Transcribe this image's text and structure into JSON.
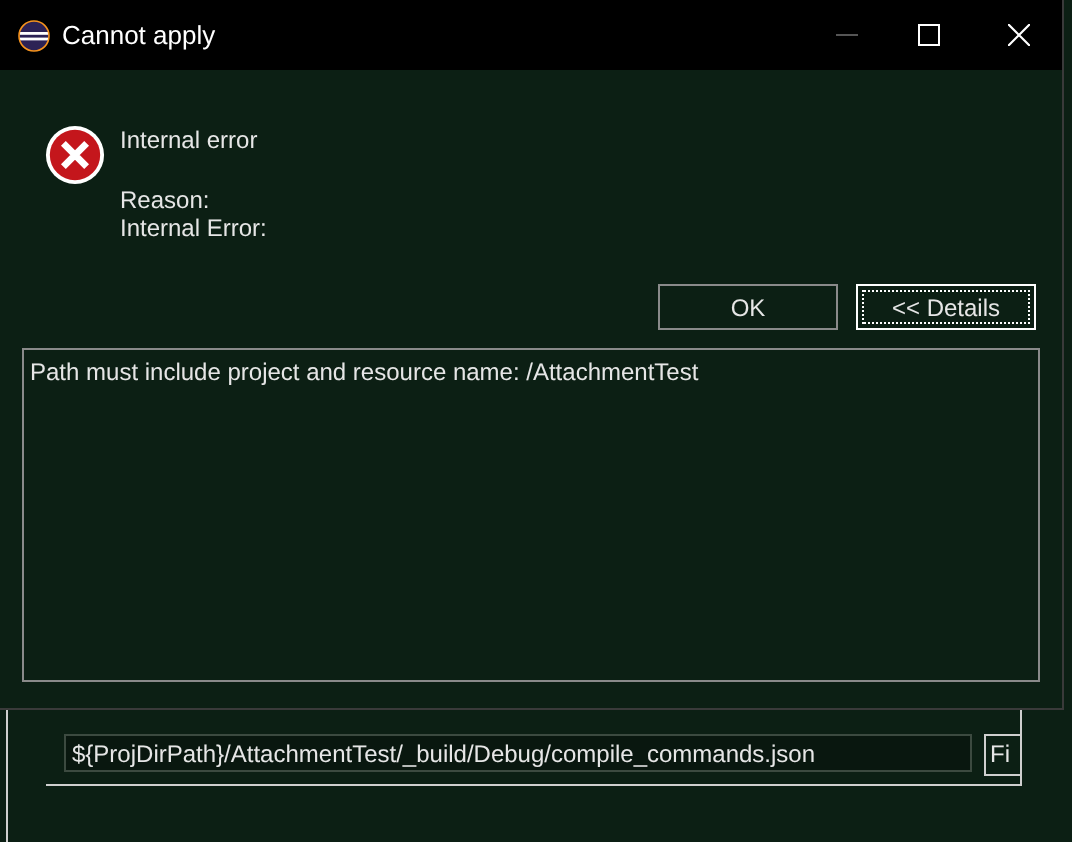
{
  "background": {
    "path_field": {
      "value": "${ProjDirPath}/AttachmentTest/_build/Debug/compile_commands.json"
    },
    "side_button": "Fi"
  },
  "dialog": {
    "title": "Cannot apply",
    "message": "Internal error",
    "reason_label": "Reason:",
    "reason_text": "Internal Error:",
    "buttons": [
      {
        "label": "OK",
        "focused": false
      },
      {
        "label": "<< Details",
        "focused": true
      }
    ],
    "details": "Path must include project and resource name: /AttachmentTest"
  }
}
